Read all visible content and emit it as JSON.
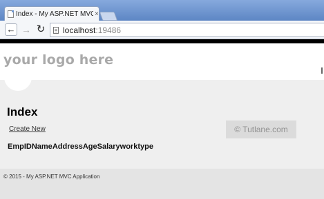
{
  "browser": {
    "tab_title": "Index - My ASP.NET MVC",
    "tab_close": "×",
    "url_host": "localhost",
    "url_port": ":19486"
  },
  "page": {
    "logo": "your logo here",
    "title": "Index",
    "create_link": "Create New",
    "watermark": "© Tutlane.com",
    "table_headers": [
      "EmpID",
      "Name",
      "Address",
      "Age",
      "Salary",
      "worktype"
    ],
    "footer": "© 2015 - My ASP.NET MVC Application"
  },
  "colors": {
    "tabstrip": "#6f97cf",
    "header_bar": "#000000",
    "main_background": "#efefef",
    "footer_background": "#e4e4e4",
    "logo_text": "#a9a9a9"
  },
  "icons": {
    "back": "back-arrow-icon",
    "forward": "forward-arrow-icon",
    "reload": "reload-icon",
    "page": "page-icon",
    "favicon": "document-icon"
  }
}
